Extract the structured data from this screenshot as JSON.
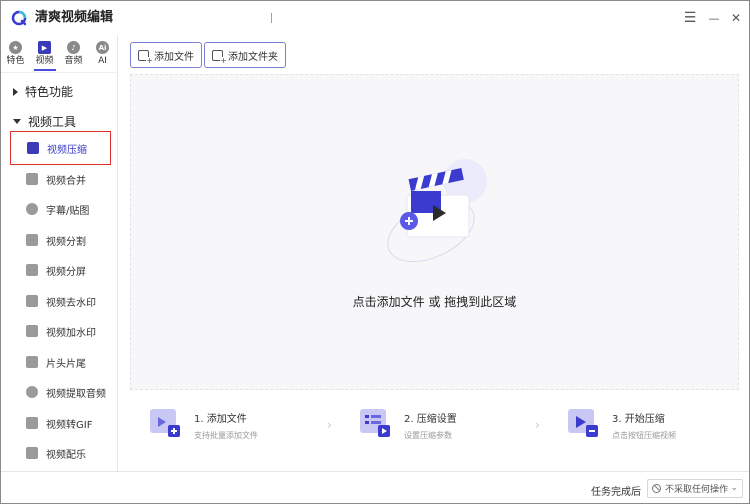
{
  "app": {
    "title": "清爽视频编辑"
  },
  "window_controls": {
    "menu": "☰",
    "minimize": "—",
    "close": "✕"
  },
  "categories": [
    {
      "label": "特色",
      "icon": "star-icon",
      "glyph": "★"
    },
    {
      "label": "视频",
      "icon": "video-icon",
      "glyph": "▶"
    },
    {
      "label": "音频",
      "icon": "audio-icon",
      "glyph": "♪"
    },
    {
      "label": "AI",
      "icon": "ai-icon",
      "glyph": "Ai"
    }
  ],
  "sidebar": {
    "section_featured": "特色功能",
    "section_video_tools": "视频工具",
    "items": [
      {
        "label": "视频压缩",
        "icon": "compress-icon"
      },
      {
        "label": "视频合并",
        "icon": "merge-icon"
      },
      {
        "label": "字幕/贴图",
        "icon": "subtitle-icon"
      },
      {
        "label": "视频分割",
        "icon": "split-icon"
      },
      {
        "label": "视频分屏",
        "icon": "split-screen-icon"
      },
      {
        "label": "视频去水印",
        "icon": "remove-watermark-icon"
      },
      {
        "label": "视频加水印",
        "icon": "add-watermark-icon"
      },
      {
        "label": "片头片尾",
        "icon": "intro-outro-icon"
      },
      {
        "label": "视频提取音频",
        "icon": "extract-audio-icon"
      },
      {
        "label": "视频转GIF",
        "icon": "gif-icon"
      },
      {
        "label": "视频配乐",
        "icon": "music-icon"
      }
    ]
  },
  "toolbar": {
    "add_file": "添加文件",
    "add_folder": "添加文件夹"
  },
  "dropzone": {
    "text": "点击添加文件 或 拖拽到此区域"
  },
  "steps": [
    {
      "title": "1. 添加文件",
      "desc": "支持批量添加文件"
    },
    {
      "title": "2. 压缩设置",
      "desc": "设置压缩参数"
    },
    {
      "title": "3. 开始压缩",
      "desc": "点击按钮压缩视频"
    }
  ],
  "statusbar": {
    "label": "任务完成后",
    "select_value": "不采取任何操作"
  },
  "colors": {
    "accent": "#4a4ae0",
    "accent_dark": "#3b3bb8",
    "highlight_border": "#d9302e"
  }
}
